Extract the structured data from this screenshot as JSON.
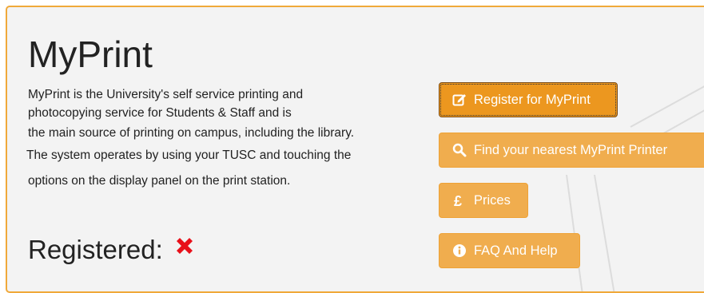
{
  "page": {
    "title": "MyPrint",
    "description_lines": [
      "MyPrint is the University's self service printing and",
      "photocopying service for Students & Staff and is",
      "the main source of printing on campus, including the library.",
      "The system operates by using your  TUSC and touching the",
      "options on the display panel on the print station."
    ],
    "registered_label": "Registered:",
    "registered_status_icon": "cross-icon"
  },
  "buttons": {
    "register": {
      "label": "Register for MyPrint",
      "icon": "edit-icon"
    },
    "find": {
      "label": "Find your nearest MyPrint Printer",
      "icon": "search-icon"
    },
    "prices": {
      "label": "Prices",
      "icon": "pound-icon"
    },
    "faq": {
      "label": "FAQ And Help",
      "icon": "info-icon"
    }
  },
  "colors": {
    "accent": "#f0ad4e",
    "accent_active": "#ec971f",
    "panel_border": "#f0a93a",
    "panel_background": "#f3f3f3",
    "status_cross": "#e8101a"
  }
}
